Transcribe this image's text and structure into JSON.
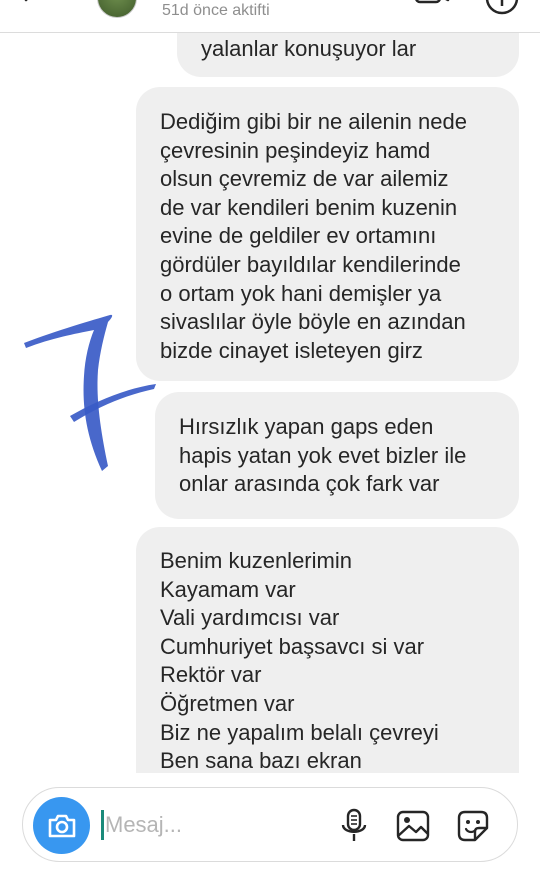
{
  "header": {
    "status": "51d önce aktifti",
    "icons": {
      "back": "back-arrow-icon",
      "video": "video-call-icon",
      "info": "info-icon",
      "avatar": "avatar"
    }
  },
  "messages": [
    {
      "lines": [
        "yalanlar konuşuyor lar"
      ]
    },
    {
      "lines": [
        "Dediğim gibi bir ne ailenin nede",
        "çevresinin peşindeyiz hamd",
        "olsun çevremiz de var ailemiz",
        "de var kendileri benim kuzenin",
        "evine de geldiler ev ortamını",
        "gördüler bayıldılar kendilerinde",
        "o ortam yok hani demişler ya",
        "sivaslılar öyle böyle en azından",
        "bizde cinayet isleteyen girz"
      ]
    },
    {
      "lines": [
        "Hırsızlık yapan gaps eden",
        "hapis yatan yok evet bizler ile",
        "onlar arasında çok fark var"
      ]
    },
    {
      "lines": [
        "Benim kuzenlerimin",
        "Kayamam var",
        "Vali yardımcısı var",
        "Cumhuriyet başsavcı si var",
        "Rektör var",
        "Öğretmen var",
        "Biz ne yapalım belalı çevreyi",
        "Ben sana bazı ekran"
      ]
    }
  ],
  "composer": {
    "placeholder": "Mesaj...",
    "value": "",
    "icons": {
      "camera": "camera-icon",
      "mic": "microphone-icon",
      "gallery": "gallery-icon",
      "sticker": "sticker-icon"
    }
  },
  "colors": {
    "bubble_bg": "#efefef",
    "text": "#262626",
    "muted_text": "#8e8e8e",
    "camera_button": "#3897f0",
    "overlay_mark": "#3a5bc7",
    "cursor": "#1a8a7a"
  }
}
